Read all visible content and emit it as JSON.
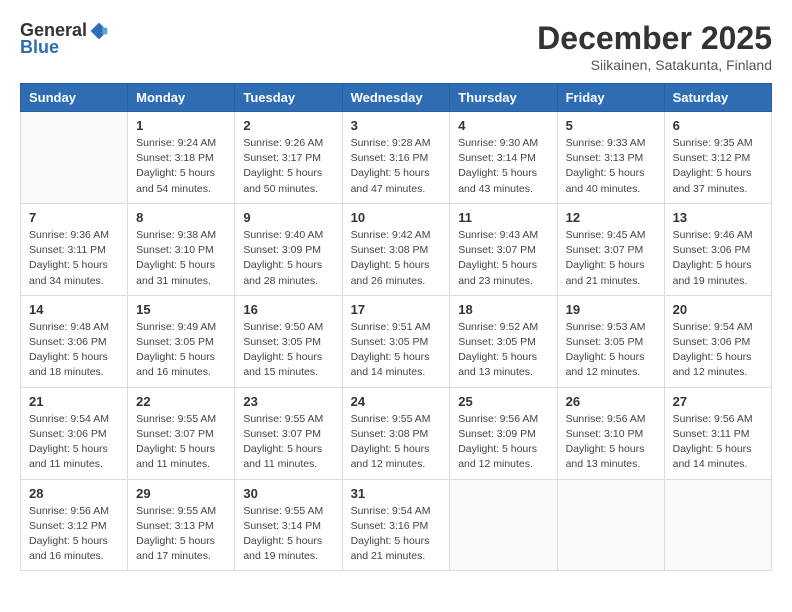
{
  "logo": {
    "general": "General",
    "blue": "Blue"
  },
  "title": "December 2025",
  "subtitle": "Siikainen, Satakunta, Finland",
  "headers": [
    "Sunday",
    "Monday",
    "Tuesday",
    "Wednesday",
    "Thursday",
    "Friday",
    "Saturday"
  ],
  "weeks": [
    [
      {
        "day": "",
        "info": ""
      },
      {
        "day": "1",
        "info": "Sunrise: 9:24 AM\nSunset: 3:18 PM\nDaylight: 5 hours\nand 54 minutes."
      },
      {
        "day": "2",
        "info": "Sunrise: 9:26 AM\nSunset: 3:17 PM\nDaylight: 5 hours\nand 50 minutes."
      },
      {
        "day": "3",
        "info": "Sunrise: 9:28 AM\nSunset: 3:16 PM\nDaylight: 5 hours\nand 47 minutes."
      },
      {
        "day": "4",
        "info": "Sunrise: 9:30 AM\nSunset: 3:14 PM\nDaylight: 5 hours\nand 43 minutes."
      },
      {
        "day": "5",
        "info": "Sunrise: 9:33 AM\nSunset: 3:13 PM\nDaylight: 5 hours\nand 40 minutes."
      },
      {
        "day": "6",
        "info": "Sunrise: 9:35 AM\nSunset: 3:12 PM\nDaylight: 5 hours\nand 37 minutes."
      }
    ],
    [
      {
        "day": "7",
        "info": "Sunrise: 9:36 AM\nSunset: 3:11 PM\nDaylight: 5 hours\nand 34 minutes."
      },
      {
        "day": "8",
        "info": "Sunrise: 9:38 AM\nSunset: 3:10 PM\nDaylight: 5 hours\nand 31 minutes."
      },
      {
        "day": "9",
        "info": "Sunrise: 9:40 AM\nSunset: 3:09 PM\nDaylight: 5 hours\nand 28 minutes."
      },
      {
        "day": "10",
        "info": "Sunrise: 9:42 AM\nSunset: 3:08 PM\nDaylight: 5 hours\nand 26 minutes."
      },
      {
        "day": "11",
        "info": "Sunrise: 9:43 AM\nSunset: 3:07 PM\nDaylight: 5 hours\nand 23 minutes."
      },
      {
        "day": "12",
        "info": "Sunrise: 9:45 AM\nSunset: 3:07 PM\nDaylight: 5 hours\nand 21 minutes."
      },
      {
        "day": "13",
        "info": "Sunrise: 9:46 AM\nSunset: 3:06 PM\nDaylight: 5 hours\nand 19 minutes."
      }
    ],
    [
      {
        "day": "14",
        "info": "Sunrise: 9:48 AM\nSunset: 3:06 PM\nDaylight: 5 hours\nand 18 minutes."
      },
      {
        "day": "15",
        "info": "Sunrise: 9:49 AM\nSunset: 3:05 PM\nDaylight: 5 hours\nand 16 minutes."
      },
      {
        "day": "16",
        "info": "Sunrise: 9:50 AM\nSunset: 3:05 PM\nDaylight: 5 hours\nand 15 minutes."
      },
      {
        "day": "17",
        "info": "Sunrise: 9:51 AM\nSunset: 3:05 PM\nDaylight: 5 hours\nand 14 minutes."
      },
      {
        "day": "18",
        "info": "Sunrise: 9:52 AM\nSunset: 3:05 PM\nDaylight: 5 hours\nand 13 minutes."
      },
      {
        "day": "19",
        "info": "Sunrise: 9:53 AM\nSunset: 3:05 PM\nDaylight: 5 hours\nand 12 minutes."
      },
      {
        "day": "20",
        "info": "Sunrise: 9:54 AM\nSunset: 3:06 PM\nDaylight: 5 hours\nand 12 minutes."
      }
    ],
    [
      {
        "day": "21",
        "info": "Sunrise: 9:54 AM\nSunset: 3:06 PM\nDaylight: 5 hours\nand 11 minutes."
      },
      {
        "day": "22",
        "info": "Sunrise: 9:55 AM\nSunset: 3:07 PM\nDaylight: 5 hours\nand 11 minutes."
      },
      {
        "day": "23",
        "info": "Sunrise: 9:55 AM\nSunset: 3:07 PM\nDaylight: 5 hours\nand 11 minutes."
      },
      {
        "day": "24",
        "info": "Sunrise: 9:55 AM\nSunset: 3:08 PM\nDaylight: 5 hours\nand 12 minutes."
      },
      {
        "day": "25",
        "info": "Sunrise: 9:56 AM\nSunset: 3:09 PM\nDaylight: 5 hours\nand 12 minutes."
      },
      {
        "day": "26",
        "info": "Sunrise: 9:56 AM\nSunset: 3:10 PM\nDaylight: 5 hours\nand 13 minutes."
      },
      {
        "day": "27",
        "info": "Sunrise: 9:56 AM\nSunset: 3:11 PM\nDaylight: 5 hours\nand 14 minutes."
      }
    ],
    [
      {
        "day": "28",
        "info": "Sunrise: 9:56 AM\nSunset: 3:12 PM\nDaylight: 5 hours\nand 16 minutes."
      },
      {
        "day": "29",
        "info": "Sunrise: 9:55 AM\nSunset: 3:13 PM\nDaylight: 5 hours\nand 17 minutes."
      },
      {
        "day": "30",
        "info": "Sunrise: 9:55 AM\nSunset: 3:14 PM\nDaylight: 5 hours\nand 19 minutes."
      },
      {
        "day": "31",
        "info": "Sunrise: 9:54 AM\nSunset: 3:16 PM\nDaylight: 5 hours\nand 21 minutes."
      },
      {
        "day": "",
        "info": ""
      },
      {
        "day": "",
        "info": ""
      },
      {
        "day": "",
        "info": ""
      }
    ]
  ]
}
